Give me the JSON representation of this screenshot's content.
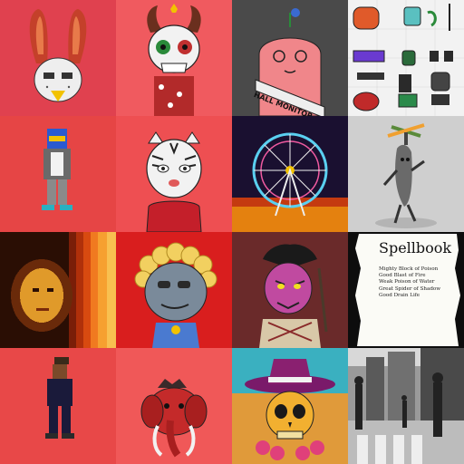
{
  "gallery": {
    "tiles": [
      {
        "subject": "rabbit-mask",
        "bg": "#e0414f"
      },
      {
        "subject": "skull-devil",
        "bg": "#f05a5f"
      },
      {
        "subject": "pink-monster",
        "bg": "#4a4a4a",
        "sash_text": "HALL MONITOR"
      },
      {
        "subject": "item-sheet",
        "bg": "#f2f2f2"
      },
      {
        "subject": "pixel-robot",
        "bg": "#e64545"
      },
      {
        "subject": "tiger",
        "bg": "#ee4f52"
      },
      {
        "subject": "ferris-wheel",
        "bg": "#1a1030"
      },
      {
        "subject": "banana-propeller",
        "bg": "#cfcfcf"
      },
      {
        "subject": "pixel-mona-lisa",
        "bg": "#e07a1a"
      },
      {
        "subject": "gray-head-curly",
        "bg": "#d91e1e"
      },
      {
        "subject": "purple-demon",
        "bg": "#6a2a2a"
      },
      {
        "subject": "spellbook",
        "bg": "#0d0d0d"
      },
      {
        "subject": "pixel-person",
        "bg": "#e84848"
      },
      {
        "subject": "red-mammoth",
        "bg": "#f05858"
      },
      {
        "subject": "skull-sombrero",
        "bg": "#e09a3a"
      },
      {
        "subject": "street-photo",
        "bg": "#808080"
      }
    ]
  },
  "spellbook": {
    "title": "Spellbook",
    "spells": [
      "Mighty Block of Poison",
      "Good Blast of Fire",
      "Weak Poison of Water",
      "Great Spider of Shadow",
      "Good Drain Life"
    ]
  }
}
